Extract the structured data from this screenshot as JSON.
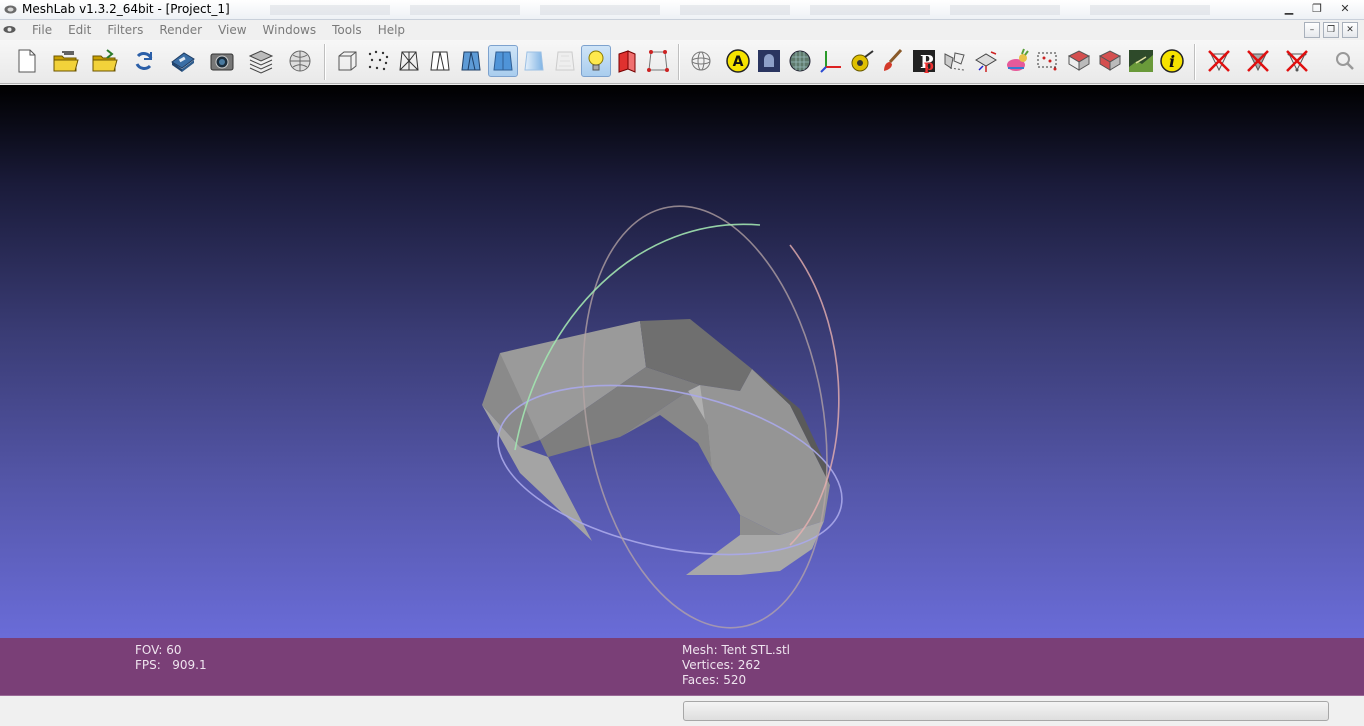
{
  "window": {
    "title": "MeshLab v1.3.2_64bit - [Project_1]",
    "controls": {
      "minimize": "▁",
      "maximize": "❐",
      "close": "✕"
    }
  },
  "menubar": {
    "items": [
      "File",
      "Edit",
      "Filters",
      "Render",
      "View",
      "Windows",
      "Tools",
      "Help"
    ],
    "mdi_controls": {
      "minimize": "–",
      "restore": "❐",
      "close": "✕"
    }
  },
  "toolbar": {
    "buttons": [
      {
        "name": "new-project",
        "icon": "new-document-icon",
        "pressed": false
      },
      {
        "name": "open-project",
        "icon": "open-folder-layers-icon",
        "pressed": false
      },
      {
        "name": "import-mesh",
        "icon": "open-folder-icon",
        "pressed": false
      },
      {
        "name": "reload",
        "icon": "reload-icon",
        "pressed": false
      },
      {
        "name": "export-mesh",
        "icon": "save-disk-icon",
        "pressed": false
      },
      {
        "name": "snapshot",
        "icon": "camera-icon",
        "pressed": false
      },
      {
        "name": "layers",
        "icon": "layers-icon",
        "pressed": false
      },
      {
        "name": "raster",
        "icon": "globe-raster-icon",
        "pressed": false
      },
      {
        "name": "bounding-box",
        "icon": "bounding-box-icon",
        "pressed": false
      },
      {
        "name": "points",
        "icon": "points-icon",
        "pressed": false
      },
      {
        "name": "wireframe",
        "icon": "wireframe-icon",
        "pressed": false
      },
      {
        "name": "hidden-lines",
        "icon": "hidden-lines-icon",
        "pressed": false
      },
      {
        "name": "flat-lines",
        "icon": "flat-lines-icon",
        "pressed": false
      },
      {
        "name": "flat",
        "icon": "flat-shading-icon",
        "pressed": true
      },
      {
        "name": "smooth",
        "icon": "smooth-shading-icon",
        "pressed": false
      },
      {
        "name": "texture",
        "icon": "texture-icon",
        "pressed": false
      },
      {
        "name": "light",
        "icon": "light-bulb-icon",
        "pressed": true
      },
      {
        "name": "double-side",
        "icon": "double-side-lighting-icon",
        "pressed": false
      },
      {
        "name": "back-face",
        "icon": "back-face-icon",
        "pressed": false
      },
      {
        "name": "trackball",
        "icon": "trackball-icon",
        "pressed": false
      },
      {
        "name": "annotation",
        "icon": "annotation-a-icon",
        "pressed": false
      },
      {
        "name": "shader",
        "icon": "shader-icon",
        "pressed": false
      },
      {
        "name": "filter-sphere",
        "icon": "sphere-filter-icon",
        "pressed": false
      },
      {
        "name": "axes",
        "icon": "axes-icon",
        "pressed": false
      },
      {
        "name": "measure",
        "icon": "measure-tape-icon",
        "pressed": false
      },
      {
        "name": "paint",
        "icon": "paintbrush-icon",
        "pressed": false
      },
      {
        "name": "pickpoints",
        "icon": "pick-points-icon",
        "pressed": false
      },
      {
        "name": "align",
        "icon": "align-icon",
        "pressed": false
      },
      {
        "name": "manipulators",
        "icon": "manipulators-icon",
        "pressed": false
      },
      {
        "name": "bunny-color",
        "icon": "bunny-icon",
        "pressed": false
      },
      {
        "name": "select-vertices",
        "icon": "select-vertices-icon",
        "pressed": false
      },
      {
        "name": "select-faces",
        "icon": "select-faces-icon",
        "pressed": false
      },
      {
        "name": "select-connected",
        "icon": "select-connected-icon",
        "pressed": false
      },
      {
        "name": "raster-align",
        "icon": "raster-align-icon",
        "pressed": false
      },
      {
        "name": "info",
        "icon": "info-icon",
        "pressed": false
      },
      {
        "name": "delete-vertices",
        "icon": "delete-vertices-icon",
        "pressed": false
      },
      {
        "name": "delete-faces",
        "icon": "delete-faces-icon",
        "pressed": false
      },
      {
        "name": "delete-faces-vertices",
        "icon": "delete-faces-vertices-icon",
        "pressed": false
      },
      {
        "name": "search",
        "icon": "search-icon",
        "pressed": false
      }
    ]
  },
  "info": {
    "fov": "FOV: 60",
    "fps": "FPS:   909.1",
    "mesh": "Mesh: Tent STL.stl",
    "vertices": "Vertices: 262",
    "faces": "Faces: 520"
  },
  "colors": {
    "info_bar": "#7a3f77",
    "viewport_top": "#000000",
    "viewport_bottom": "#6a6cd8",
    "mesh": "#8a8a8a"
  }
}
